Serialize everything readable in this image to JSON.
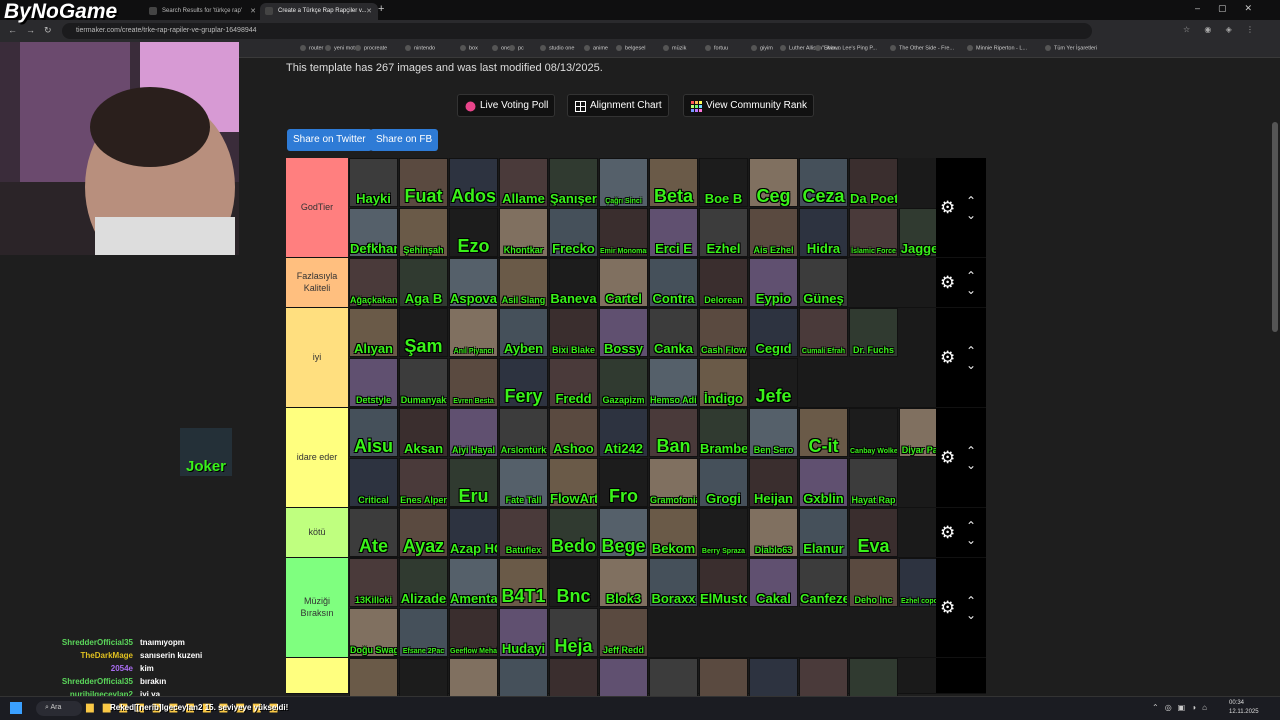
{
  "stream": {
    "logo": "ByNoGame",
    "overlay_banner": "Reked[[nerib]lgeceylan2 15. seviyeye yükseldi!"
  },
  "browser": {
    "tabs": [
      {
        "label": "Search Results for 'türkçe rap'",
        "active": false
      },
      {
        "label": "Create a Türkçe Rap Rapçiler v...",
        "active": true
      }
    ],
    "url": "tiermaker.com/create/trke-rap-rapiler-ve-gruplar-16498944",
    "bookmarks": [
      "router",
      "yeni motor",
      "procreate",
      "nintendo",
      "box",
      "one p",
      "pc",
      "studio one",
      "anime",
      "belgesel",
      "müzik",
      "fortuu",
      "giyim",
      "Luther Allison\"Livin...",
      "Shawn Lee's Ping P...",
      "The Other Side - Fre...",
      "Minnie Riperton - L...",
      "Tüm Yer İşaretleri"
    ]
  },
  "page": {
    "info_text": "This template has 267 images and was last modified 08/13/2025.",
    "buttons": {
      "live_voting": "Live Voting Poll",
      "alignment": "Alignment Chart",
      "community": "View Community Rank"
    },
    "share": {
      "twitter": "Share on Twitter",
      "facebook": "Share on FB"
    },
    "floating_item": "Joker"
  },
  "tiers": [
    {
      "label": "GodTier",
      "color": "#ff7f7f",
      "items": [
        [
          "Hayki",
          "Fuat",
          "Ados",
          "Allame",
          "Şanışer",
          "Çağrı Sinci",
          "Beta",
          "Boe B",
          "Ceg",
          "Ceza",
          "Da Poet"
        ],
        [
          "Defkhan",
          "Şehinşah",
          "Ezo",
          "Khontkar",
          "Frecko",
          "Emir Monoman",
          "Erci E",
          "Ezhel",
          "Ais Ezhel",
          "Hidra",
          "İslamic Force",
          "Jagged"
        ]
      ]
    },
    {
      "label": "Fazlasıyla Kaliteli",
      "color": "#ffbf7f",
      "items": [
        [
          "Ağaçkakan",
          "Aga B",
          "Aspova",
          "Asil Slang",
          "Baneva",
          "Cartel",
          "Contra",
          "Delorean",
          "Eypio",
          "Güneş"
        ]
      ]
    },
    {
      "label": "iyi",
      "color": "#ffdf7f",
      "items": [
        [
          "Alıyan",
          "Şam",
          "Anıl Piyancı",
          "Ayben",
          "Bixi Blake",
          "Bossy",
          "Canka",
          "Cash Flow",
          "Cegıd",
          "Cumali Efrah",
          "Dr. Fuchs"
        ],
        [
          "Detstyle",
          "Dumanyak",
          "Evren Besta",
          "Fery",
          "Fredd",
          "Gazapizm",
          "Hemso Adil",
          "İndigo",
          "Jefe"
        ]
      ]
    },
    {
      "label": "idare eder",
      "color": "#ffff7f",
      "items": [
        [
          "Aisu",
          "Aksan",
          "Aiyi Hayal",
          "Arslontürk",
          "Ashoo",
          "Ati242",
          "Ban",
          "Brambel",
          "Ben Sero",
          "C-it",
          "Canbay Wolker",
          "Diyar Pala"
        ],
        [
          "Critical",
          "Enes Alper",
          "Eru",
          "Fate Tall",
          "FlowArt",
          "Fro",
          "Gramofonia",
          "Grogi",
          "Heijan",
          "Gxblin",
          "Hayat Rap"
        ]
      ]
    },
    {
      "label": "kötü",
      "color": "#bfff7f",
      "items": [
        [
          "Ate",
          "Ayaz",
          "Azap HG",
          "Batuflex",
          "Bedo",
          "Bege",
          "Bekom",
          "Berry Spraza",
          "Diablo63",
          "Elanur",
          "Eva"
        ]
      ]
    },
    {
      "label": "Müziği Bıraksın",
      "color": "#7fff7f",
      "items": [
        [
          "13Killoki",
          "Alizade",
          "Amenta",
          "B4T1",
          "Bnc",
          "Blok3",
          "Boraxx",
          "ElMusto",
          "Cakal",
          "Canfeze",
          "Deho Inc",
          "Ezhel copone"
        ],
        [
          "Doğu Swag",
          "Efsane 2Pac",
          "Geeflow Mehab",
          "Hudayi",
          "Heja",
          "Jeff Redd"
        ]
      ]
    },
    {
      "label": "",
      "color": "#ffff7f",
      "items": [
        [
          "",
          "",
          "",
          "",
          "",
          "",
          "",
          "",
          "",
          "",
          ""
        ]
      ]
    }
  ],
  "chat": [
    {
      "user": "ShredderOfficial35",
      "msg": "tnaımıyopm",
      "color": "#5bd75b"
    },
    {
      "user": "TheDarkMage",
      "msg": "sanıserin kuzeni",
      "color": "#e0c020"
    },
    {
      "user": "2054e",
      "msg": "kim",
      "color": "#a86cf0"
    },
    {
      "user": "ShredderOfficial35",
      "msg": "bırakın",
      "color": "#5bd75b"
    },
    {
      "user": "nuribilgeceylan2",
      "msg": "iyi ya",
      "color": "#5bd75b"
    }
  ],
  "taskbar": {
    "search": "Ara",
    "time": "00:34",
    "date": "12.11.2025"
  }
}
